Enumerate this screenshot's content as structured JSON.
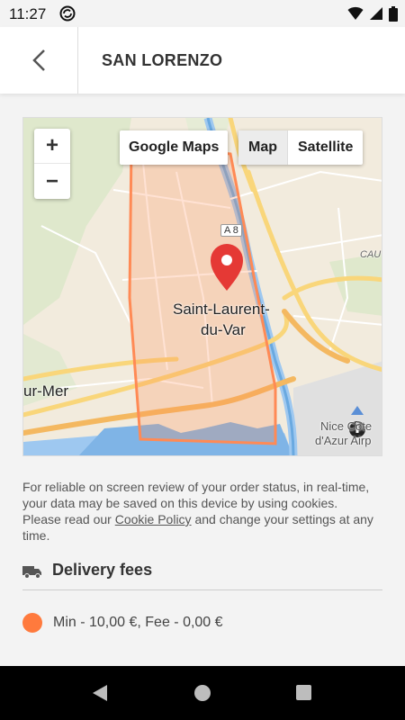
{
  "status": {
    "time": "11:27"
  },
  "header": {
    "title": "SAN LORENZO"
  },
  "map": {
    "zoom_in": "+",
    "zoom_out": "−",
    "google_maps_label": "Google Maps",
    "type_map": "Map",
    "type_satellite": "Satellite",
    "town_label_line1": "Saint-Laurent-",
    "town_label_line2": "du-Var",
    "west_label": "ur-Mer",
    "east_label": "CAU",
    "road_label": "A 8",
    "airport_label_line1": "Nice Côte",
    "airport_label_line2": "d'Azur Airp",
    "zone_color": "#ff8a55",
    "marker_color": "#e53935"
  },
  "privacy": {
    "text_before": "For reliable on screen review of your order status, in real-time, your data may be saved on this device by using cookies. Please read our ",
    "link": "Cookie Policy",
    "text_after": " and change your settings at any time."
  },
  "delivery": {
    "title": "Delivery fees",
    "fee_text": "Min - 10,00 €, Fee - 0,00 €",
    "fee_color": "#ff7a3d"
  }
}
